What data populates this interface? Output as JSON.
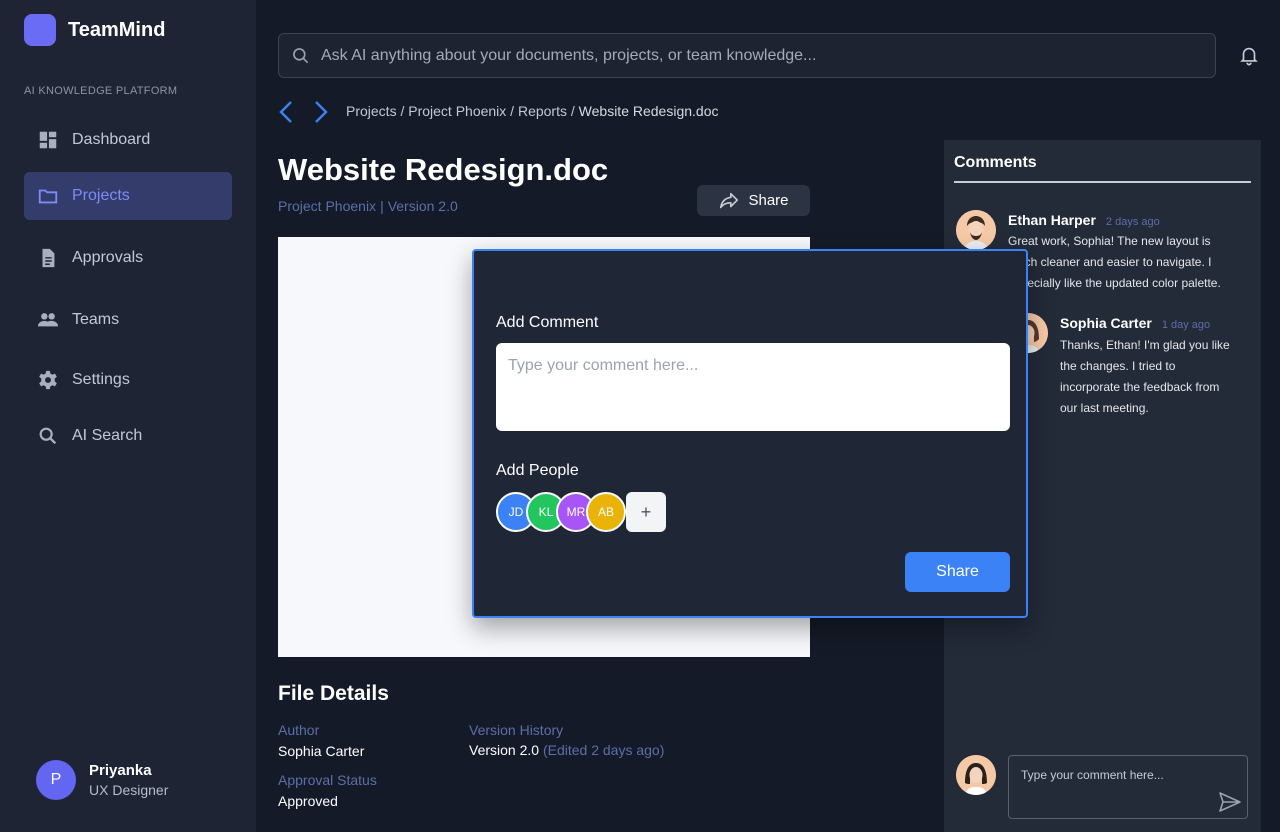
{
  "app": {
    "name": "TeamMind",
    "section_label": "AI KNOWLEDGE PLATFORM"
  },
  "sidebar": {
    "items": [
      {
        "label": "Dashboard",
        "icon": "dashboard-icon",
        "active": false
      },
      {
        "label": "Projects",
        "icon": "folder-icon",
        "active": true
      },
      {
        "label": "Approvals",
        "icon": "document-icon",
        "active": false
      },
      {
        "label": "Teams",
        "icon": "people-icon",
        "active": false
      },
      {
        "label": "Settings",
        "icon": "gear-icon",
        "active": false
      },
      {
        "label": "AI Search",
        "icon": "search-icon",
        "active": false
      }
    ]
  },
  "user": {
    "initial": "P",
    "name": "Priyanka",
    "role": "UX Designer"
  },
  "search": {
    "placeholder": "Ask AI anything about your documents, projects, or team knowledge..."
  },
  "breadcrumb": {
    "path": "Projects / Project Phoenix / Reports / ",
    "current": "Website Redesign.doc"
  },
  "document": {
    "title": "Website Redesign.doc",
    "project": "Project Phoenix",
    "separator": "|",
    "version": "Version 2.0",
    "share_label": "Share"
  },
  "file_details": {
    "title": "File Details",
    "author_label": "Author",
    "author": "Sophia Carter",
    "approval_label": "Approval Status",
    "approval": "Approved",
    "version_history_label": "Version History",
    "version": "Version 2.0",
    "edited": "(Edited 2 days ago)"
  },
  "comments": {
    "title": "Comments",
    "items": [
      {
        "author": "Ethan Harper",
        "time": "2 days ago",
        "text": "Great work, Sophia! The new layout is much cleaner and easier to navigate. I especially like the updated color palette."
      },
      {
        "author": "Sophia Carter",
        "time": "1 day ago",
        "text": "Thanks, Ethan! I'm glad you like the changes. I tried to incorporate the feedback from our last meeting."
      }
    ],
    "input_placeholder": "Type your comment here..."
  },
  "modal": {
    "comment_label": "Add Comment",
    "comment_placeholder": "Type your comment here...",
    "people_label": "Add People",
    "people": [
      {
        "initials": "JD",
        "color": "#3b82f6"
      },
      {
        "initials": "KL",
        "color": "#22c55e"
      },
      {
        "initials": "MR",
        "color": "#a855f7"
      },
      {
        "initials": "AB",
        "color": "#eab308"
      }
    ],
    "add_symbol": "+",
    "share_label": "Share"
  },
  "colors": {
    "accent": "#3b82f6",
    "brand": "#6b6cf6",
    "active_nav": "#343c6b"
  }
}
